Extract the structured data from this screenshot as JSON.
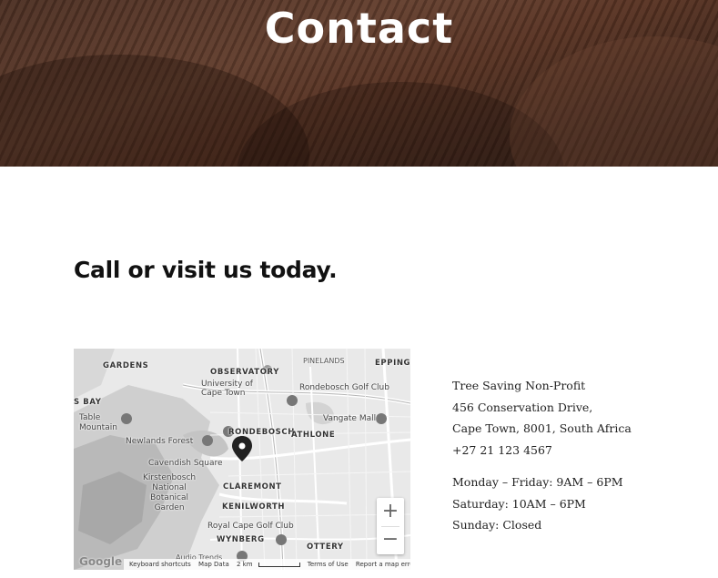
{
  "hero": {
    "title": "Contact"
  },
  "section": {
    "heading": "Call or visit us today."
  },
  "map": {
    "labels": {
      "gardens": "GARDENS",
      "observatory": "OBSERVATORY",
      "pinelands": "PINELANDS",
      "epping": "EPPING",
      "bay": "S BAY",
      "uct": "University of\nCape Town",
      "rondebosch_golf": "Rondebosch Golf Club",
      "table_mountain": "Table\nMountain",
      "vangate": "Vangate Mall",
      "newlands": "Newlands Forest",
      "rondebosch": "RONDEBOSCH",
      "athlone": "ATHLONE",
      "cavendish": "Cavendish Square",
      "kirstenbosch": "Kirstenbosch\nNational\nBotanical\nGarden",
      "claremont": "CLAREMONT",
      "kenilworth": "KENILWORTH",
      "royal_cape": "Royal Cape Golf Club",
      "wynberg": "WYNBERG",
      "ottery": "OTTERY",
      "audio_trends": "Audio Trends"
    },
    "zoom_in": "+",
    "zoom_out": "−",
    "footer": {
      "logo": "Google",
      "shortcuts": "Keyboard shortcuts",
      "map_data": "Map Data",
      "scale": "2 km",
      "terms": "Terms of Use",
      "report": "Report a map error"
    }
  },
  "contact": {
    "org": "Tree Saving Non-Profit",
    "address1": "456 Conservation Drive,",
    "address2": "Cape Town, 8001, South Africa",
    "phone": "+27 21 123 4567",
    "hours": [
      "Monday – Friday: 9AM – 6PM",
      "Saturday: 10AM – 6PM",
      "Sunday: Closed"
    ]
  }
}
